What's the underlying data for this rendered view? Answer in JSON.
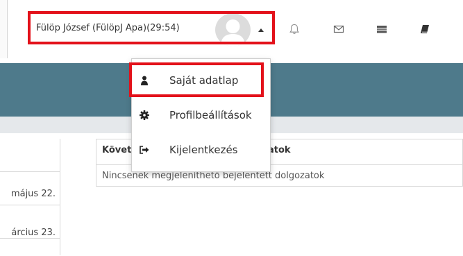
{
  "header": {
    "user_display": "Fülöp József (FülöpJ Apa)(29:54)",
    "icons": [
      "avatar-icon",
      "caret-up-icon",
      "bell-icon",
      "envelope-icon",
      "grade-book-icon",
      "book-icon"
    ]
  },
  "user_menu": {
    "items": [
      {
        "label": "Saját adatlap",
        "icon": "user-icon"
      },
      {
        "label": "Profilbeállítások",
        "icon": "gear-icon"
      },
      {
        "label": "Kijelentkezés",
        "icon": "sign-out-icon"
      }
    ]
  },
  "left_column": {
    "cells": [
      "május 22.",
      "árcius 23."
    ]
  },
  "submissions_table": {
    "header_prefix": "Követ",
    "header_suffix": "atok",
    "empty_message": "Nincsenek megjeleníthető bejelentett dolgozatok"
  },
  "colors": {
    "highlight": "#e3111a",
    "band": "#4e7a8b",
    "band_light": "#e5e8eb"
  }
}
